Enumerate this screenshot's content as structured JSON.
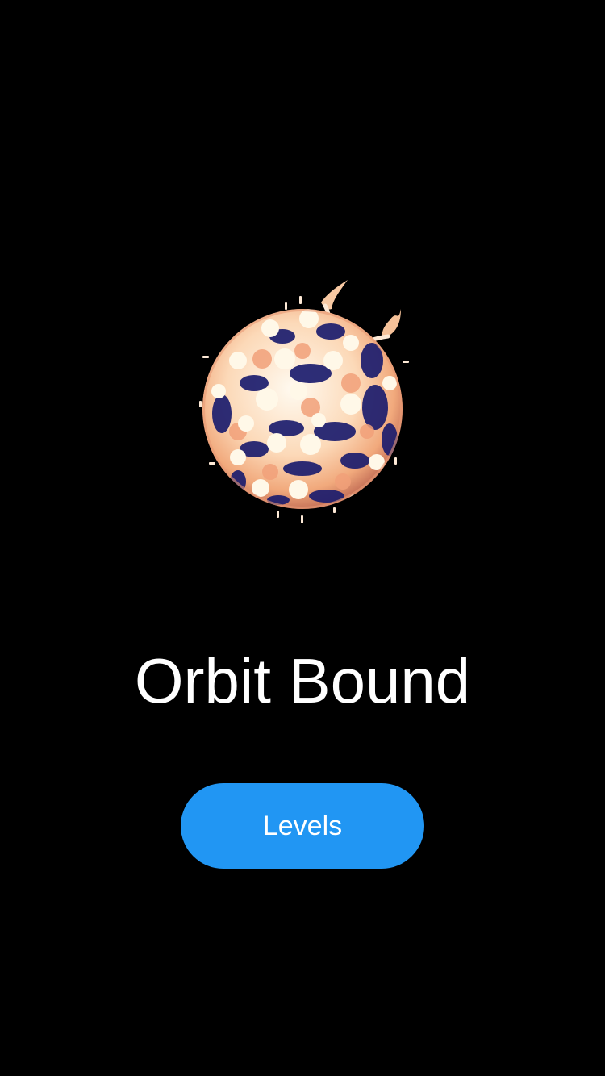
{
  "screen": {
    "background_color": "#000000"
  },
  "hero": {
    "icon": "burning-star-planet",
    "colors": {
      "hot": "#fff8e8",
      "warm": "#f5c199",
      "dark": "#1c1d6e"
    }
  },
  "title": {
    "text": "Orbit Bound",
    "color": "#ffffff"
  },
  "menu": {
    "levels_label": "Levels",
    "button_color": "#2196f3"
  }
}
